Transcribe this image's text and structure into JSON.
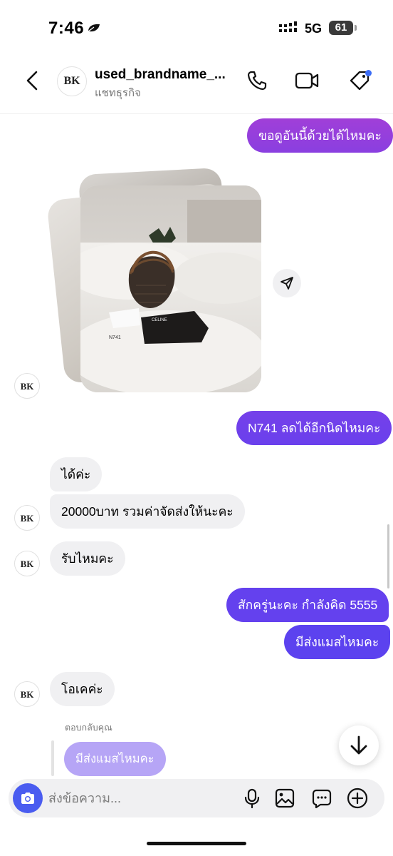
{
  "status_bar": {
    "time": "7:46",
    "network": "5G",
    "battery": "61"
  },
  "header": {
    "contact_name": "used_brandname_...",
    "contact_subtitle": "แชทธุรกิจ",
    "avatar_logo": "BK"
  },
  "conversation": {
    "outgoing_1": "ขอดูอันนี้ด้วยได้ไหมคะ",
    "outgoing_2": "N741 ลดได้อีกนิดไหมคะ",
    "incoming_1": "ได้ค่ะ",
    "incoming_2": "20000บาท รวมค่าจัดส่งให้นะคะ",
    "incoming_3": "รับไหมคะ",
    "outgoing_3": "สักครู่นะคะ กำลังคิด 5555",
    "outgoing_4": "มีส่งแมสไหมคะ",
    "incoming_4": "โอเคค่ะ",
    "reply_label": "ตอบกลับคุณ",
    "reply_quote": "มีส่งแมสไหมคะ"
  },
  "photo": {
    "product_code": "N741",
    "brand_text": "CELINE"
  },
  "composer": {
    "placeholder": "ส่งข้อความ..."
  },
  "colors": {
    "outgoing_gradient_top": "#9a3fdc",
    "outgoing_gradient_bottom": "#5b3ff0",
    "incoming_bg": "#f0f0f2",
    "camera_button": "#4a5cf0",
    "reply_bubble": "#b6a5f6",
    "notification_dot": "#3b6cf6"
  },
  "icons": [
    "leaf-icon",
    "signal-icon",
    "back-arrow-icon",
    "phone-icon",
    "video-camera-icon",
    "tag-icon",
    "send-icon",
    "arrow-down-icon",
    "camera-icon",
    "microphone-icon",
    "gallery-icon",
    "sticker-icon",
    "plus-icon"
  ]
}
